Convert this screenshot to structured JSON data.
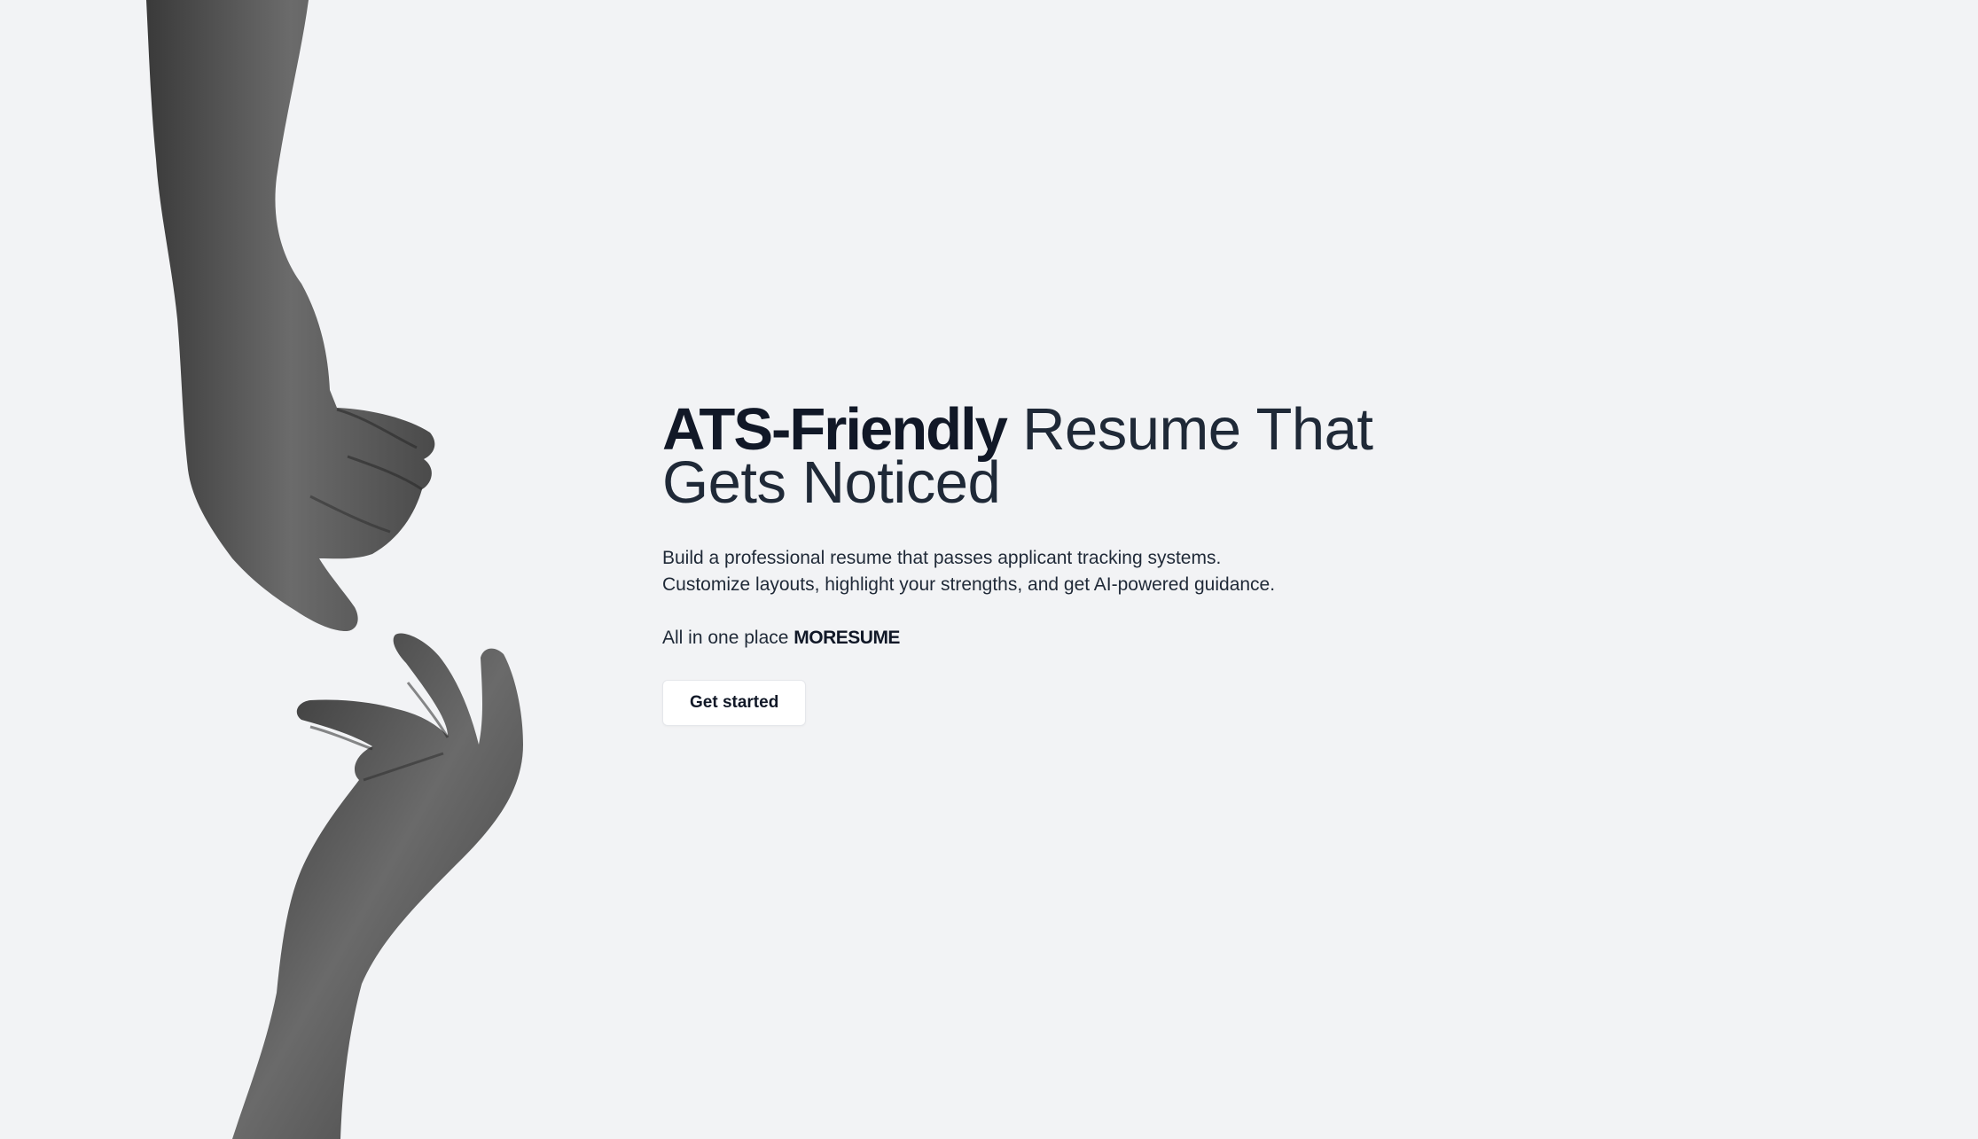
{
  "hero": {
    "headline_bold": "ATS-Friendly",
    "headline_light": " Resume That Gets Noticed",
    "description_line1": "Build a professional resume that passes applicant tracking systems.",
    "description_line2": "Customize layouts, highlight your strengths, and get AI-powered guidance.",
    "tagline_prefix": "All in one place ",
    "brand_name": "MORESUME",
    "cta_label": "Get started"
  },
  "artwork": {
    "icon": "reaching-hands-illustration",
    "tone": "grayscale"
  },
  "colors": {
    "background": "#f2f3f5",
    "text_primary": "#111827",
    "button_bg": "#ffffff"
  }
}
